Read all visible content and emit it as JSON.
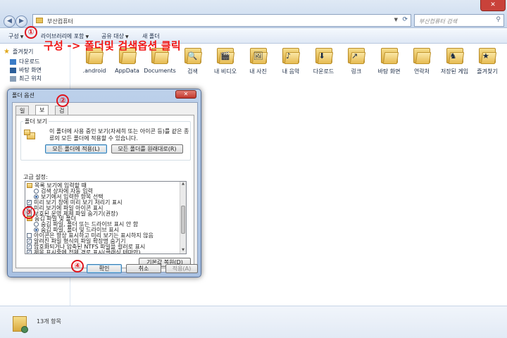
{
  "window": {
    "address": "부산컴퓨터",
    "search_placeholder": "부산컴퓨터 검색",
    "back_glyph": "◀",
    "forward_glyph": "▶",
    "close_glyph": "✕"
  },
  "toolbar": {
    "organize": "구성",
    "include_library": "라이브러리에 포함",
    "share": "공유 대상",
    "new_folder": "새 폴더"
  },
  "sidebar": {
    "favorites": "즐겨찾기",
    "items": [
      "다운로드",
      "바탕 화면",
      "최근 위치"
    ]
  },
  "folders": [
    {
      "label": ".android",
      "glyph": ""
    },
    {
      "label": "AppData",
      "glyph": ""
    },
    {
      "label": "Documents",
      "glyph": ""
    },
    {
      "label": "검색",
      "glyph": "🔍"
    },
    {
      "label": "내 비디오",
      "glyph": "🎬"
    },
    {
      "label": "내 사진",
      "glyph": "🖼"
    },
    {
      "label": "내 음악",
      "glyph": "♪"
    },
    {
      "label": "다운로드",
      "glyph": "⬇"
    },
    {
      "label": "링크",
      "glyph": "↗"
    },
    {
      "label": "바탕 화면",
      "glyph": ""
    },
    {
      "label": "연락처",
      "glyph": ""
    },
    {
      "label": "저장된 게임",
      "glyph": "♞"
    },
    {
      "label": "즐겨찾기",
      "glyph": "★"
    }
  ],
  "status": {
    "count": "13개 항목"
  },
  "dialog": {
    "title": "폴더 옵션",
    "close": "✕",
    "tabs": [
      "일반",
      "보기",
      "검색"
    ],
    "folder_views": {
      "group": "폴더 보기",
      "description": "이 폴더에 사용 중인 보기(자세히 또는 아이콘 등)를 같은 종류의 모든 폴더에 적용할 수 있습니다.",
      "apply_button": "모든 폴더에 적용(L)",
      "reset_button": "모든 폴더를 원래대로(R)"
    },
    "advanced_label": "고급 설정:",
    "settings": [
      {
        "type": "folder",
        "label": "목록 보기에 입력할 때"
      },
      {
        "type": "radio",
        "checked": false,
        "label": "검색 상자에 자동 입력"
      },
      {
        "type": "radio",
        "checked": true,
        "label": "보기에서 입력한 항목 선택"
      },
      {
        "type": "check",
        "checked": true,
        "label": "미리 보기 창에 미리 보기 처리기 표시"
      },
      {
        "type": "check",
        "checked": true,
        "label": "미리 보기에 파일 아이콘 표시"
      },
      {
        "type": "check",
        "checked": true,
        "label": "보호된 운영 체제 파일 숨기기(권장)"
      },
      {
        "type": "folder",
        "label": "숨김 파일 및 폴더"
      },
      {
        "type": "radio",
        "checked": false,
        "label": "숨김 파일, 폴더 또는 드라이브 표시 안 함"
      },
      {
        "type": "radio",
        "checked": true,
        "label": "숨김 파일, 폴더 및 드라이브 표시"
      },
      {
        "type": "check",
        "checked": false,
        "label": "아이콘은 항상 표시하고 미리 보기는 표시하지 않음"
      },
      {
        "type": "check",
        "checked": true,
        "label": "알려진 파일 형식의 파일 확장명 숨기기"
      },
      {
        "type": "check",
        "checked": true,
        "label": "암호화되거나 압축된 NTFS 파일을 컬러로 표시"
      },
      {
        "type": "check",
        "checked": true,
        "label": "제목 표시줄에 전체 경로 표시(클래식 테마만)"
      }
    ],
    "restore_defaults": "기본값 복원(D)",
    "ok": "확인",
    "cancel": "취소",
    "apply": "적용(A)"
  },
  "annotations": {
    "callout": "구성 -> 폴더및 검색옵션 클릭",
    "step1": "①",
    "step2": "②",
    "step3": "③",
    "step4": "④"
  }
}
